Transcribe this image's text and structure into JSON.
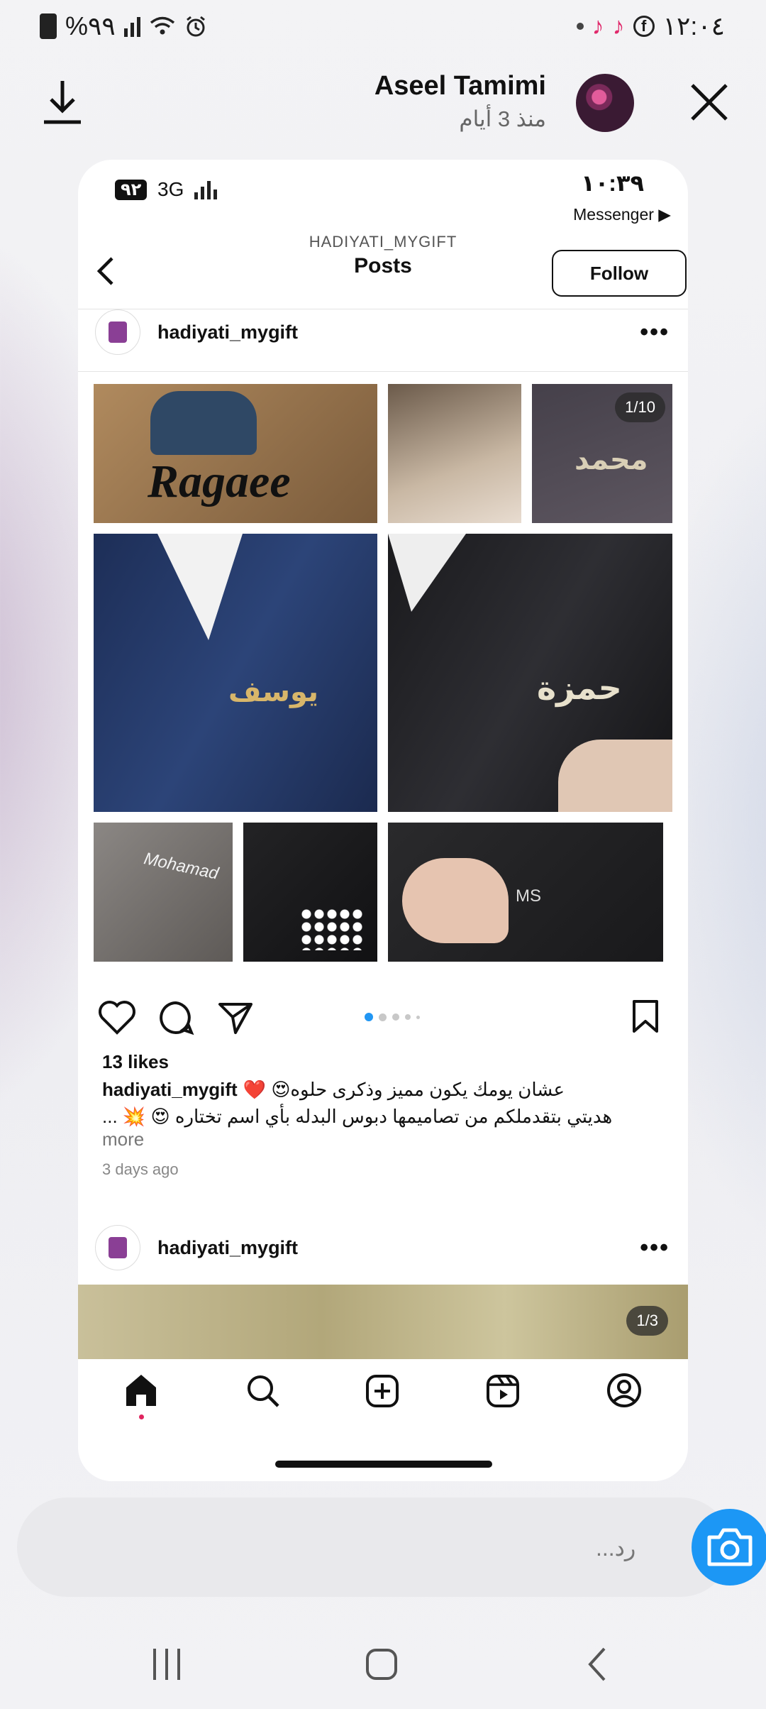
{
  "status_bar": {
    "battery": "%٩٩",
    "time": "١٢:٠٤"
  },
  "story": {
    "name": "Aseel Tamimi",
    "time_ago": "منذ 3 أيام"
  },
  "screenshot": {
    "status": {
      "badge": "٩٢",
      "network": "3G",
      "time": "١٠:٣٩",
      "back_app": "Messenger ▶"
    },
    "header": {
      "username_caps": "HADIYATI_MYGIFT",
      "title": "Posts",
      "follow_label": "Follow"
    },
    "post": {
      "username": "hadiyati_mygift",
      "counter": "1/10",
      "likes": "13 likes",
      "caption_line1": "عشان يومك يكون مميز وذكرى حلوه😍 ❤️",
      "caption_line2": "هديتي بتقدملكم من تصاميمها دبوس البدله بأي اسم تختاره 😍 💥 ...",
      "more": "more",
      "date": "3 days ago",
      "image_texts": [
        "Ragaee",
        "محمد",
        "يوسف",
        "حمزة",
        "Mohamad",
        "MS"
      ]
    },
    "next_post": {
      "username": "hadiyati_mygift",
      "counter": "1/3"
    }
  },
  "reply": {
    "placeholder": "رد..."
  },
  "icons": [
    "download-icon",
    "close-icon",
    "back-chevron-icon",
    "more-icon",
    "heart-icon",
    "comment-icon",
    "share-icon",
    "bookmark-icon",
    "home-icon",
    "search-icon",
    "create-icon",
    "reels-icon",
    "profile-icon",
    "camera-icon"
  ]
}
